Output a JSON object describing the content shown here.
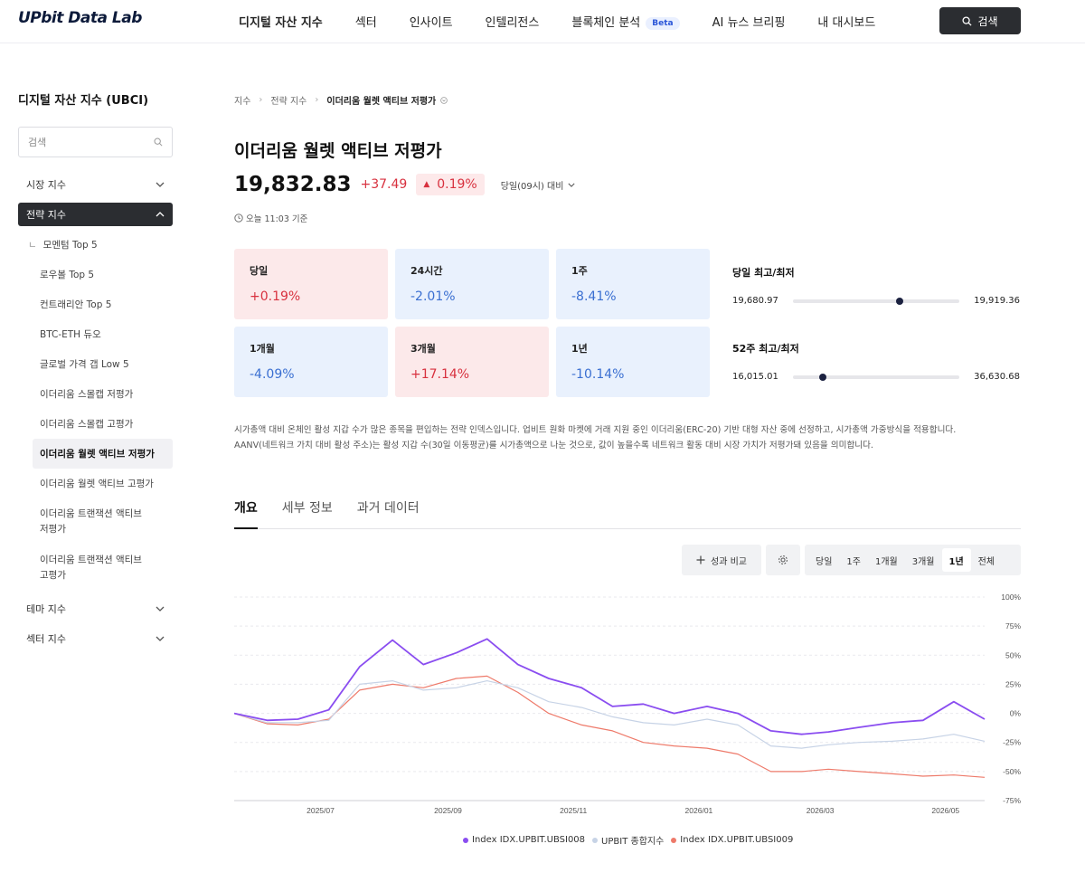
{
  "header": {
    "logo": "UPbit Data Lab",
    "nav": [
      {
        "label": "디지털 자산 지수",
        "active": true
      },
      {
        "label": "섹터"
      },
      {
        "label": "인사이트"
      },
      {
        "label": "인텔리전스"
      },
      {
        "label": "블록체인 분석",
        "badge": "Beta"
      },
      {
        "label": "AI 뉴스 브리핑"
      },
      {
        "label": "내 대시보드"
      }
    ],
    "search_label": "검색"
  },
  "sidebar": {
    "title": "디지털 자산 지수 (UBCI)",
    "search_placeholder": "검색",
    "groups": [
      "시장 지수",
      "전략 지수",
      "테마 지수",
      "섹터 지수"
    ],
    "strategy_items": [
      "모멘텀 Top 5",
      "로우볼 Top 5",
      "컨트래리안 Top 5",
      "BTC-ETH 듀오",
      "글로벌 가격 갭 Low 5",
      "이더리움 스몰캡 저평가",
      "이더리움 스몰캡 고평가",
      "이더리움 월렛 액티브 저평가",
      "이더리움 월렛 액티브 고평가",
      "이더리움 트랜잭션 액티브 저평가",
      "이더리움 트랜잭션 액티브 고평가"
    ]
  },
  "breadcrumb": [
    "지수",
    "전략 지수",
    "이더리움 월렛 액티브 저평가"
  ],
  "index": {
    "title": "이더리움 월렛 액티브 저평가",
    "price": "19,832.83",
    "change": "+37.49",
    "change_pct": "0.19%",
    "basis": "당일(09시) 대비",
    "as_of": "오늘 11:03 기준"
  },
  "returns": [
    {
      "label": "당일",
      "value": "+0.19%",
      "dir": "up"
    },
    {
      "label": "24시간",
      "value": "-2.01%",
      "dir": "down"
    },
    {
      "label": "1주",
      "value": "-8.41%",
      "dir": "down"
    },
    {
      "label": "1개월",
      "value": "-4.09%",
      "dir": "down"
    },
    {
      "label": "3개월",
      "value": "+17.14%",
      "dir": "up"
    },
    {
      "label": "1년",
      "value": "-10.14%",
      "dir": "down"
    }
  ],
  "ranges": [
    {
      "title": "당일 최고/최저",
      "low": "19,680.97",
      "high": "19,919.36",
      "position": 0.64
    },
    {
      "title": "52주 최고/최저",
      "low": "16,015.01",
      "high": "36,630.68",
      "position": 0.18
    }
  ],
  "description": {
    "line1": "시가총액 대비 온체인 활성 지갑 수가 많은 종목을 편입하는 전략 인덱스입니다. 업비트 원화 마켓에 거래 지원 중인 이더리움(ERC-20) 기반 대형 자산 중에 선정하고, 시가총액 가중방식을 적용합니다.",
    "line2": "AANV(네트워크 가치 대비 활성 주소)는 활성 지갑 수(30일 이동평균)를 시가총액으로 나눈 것으로, 값이 높을수록 네트워크 활동 대비 시장 가치가 저평가돼 있음을 의미합니다."
  },
  "tabs": [
    "개요",
    "세부 정보",
    "과거 데이터"
  ],
  "controls": {
    "compare_label": "성과 비교",
    "periods": [
      "당일",
      "1주",
      "1개월",
      "3개월",
      "1년",
      "전체"
    ],
    "active_period": "1년"
  },
  "colors": {
    "up": "#d8313f",
    "down": "#3a6fd1",
    "series_main": "#8a4df0",
    "series_upbit": "#c7d3e6",
    "series_other": "#ee7a6a"
  },
  "chart_data": {
    "type": "line",
    "y_unit": "%",
    "ylim": [
      -75,
      100
    ],
    "yticks": [
      "100%",
      "75%",
      "50%",
      "25%",
      "0%",
      "-25%",
      "-50%",
      "-75%"
    ],
    "x_tick_labels": [
      "2025/07",
      "2025/09",
      "2025/11",
      "2026/01",
      "2026/03",
      "2026/05"
    ],
    "x": [
      "2025-05-20",
      "2025-06-05",
      "2025-06-20",
      "2025-07-05",
      "2025-07-20",
      "2025-08-05",
      "2025-08-20",
      "2025-09-05",
      "2025-09-20",
      "2025-10-05",
      "2025-10-20",
      "2025-11-05",
      "2025-11-20",
      "2025-12-05",
      "2025-12-20",
      "2026-01-05",
      "2026-01-20",
      "2026-02-05",
      "2026-02-20",
      "2026-03-05",
      "2026-03-20",
      "2026-04-05",
      "2026-04-20",
      "2026-05-05",
      "2026-05-20"
    ],
    "series": [
      {
        "name": "Index IDX.UPBIT.UBSI008",
        "color": "#8a4df0",
        "values": [
          0,
          -6,
          -5,
          3,
          40,
          63,
          42,
          52,
          64,
          42,
          30,
          22,
          6,
          8,
          0,
          6,
          0,
          -15,
          -18,
          -16,
          -12,
          -8,
          -6,
          10,
          -5
        ]
      },
      {
        "name": "UPBIT 종합지수",
        "color": "#c7d3e6",
        "values": [
          0,
          -8,
          -8,
          -6,
          25,
          28,
          20,
          22,
          28,
          22,
          10,
          5,
          -3,
          -8,
          -10,
          -5,
          -10,
          -28,
          -30,
          -27,
          -25,
          -24,
          -22,
          -18,
          -24
        ]
      },
      {
        "name": "Index IDX.UPBIT.UBSI009",
        "color": "#ee7a6a",
        "values": [
          0,
          -9,
          -10,
          -5,
          20,
          25,
          22,
          30,
          32,
          18,
          0,
          -10,
          -15,
          -25,
          -28,
          -30,
          -35,
          -50,
          -50,
          -48,
          -50,
          -52,
          -54,
          -53,
          -55
        ]
      }
    ]
  }
}
